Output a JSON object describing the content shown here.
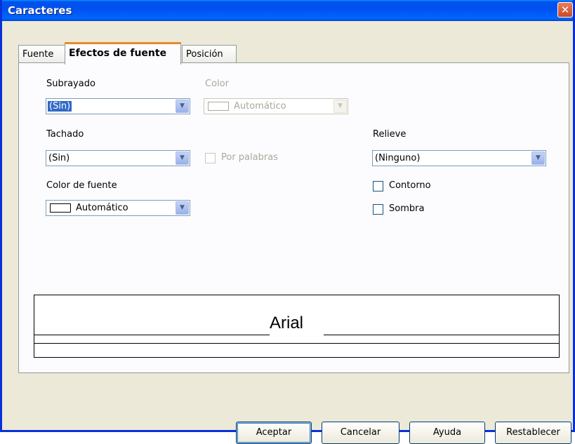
{
  "window": {
    "title": "Caracteres",
    "close_glyph": "✕"
  },
  "tabs": [
    {
      "label": "Fuente"
    },
    {
      "label": "Efectos de fuente"
    },
    {
      "label": "Posición"
    }
  ],
  "subrayado": {
    "label": "Subrayado",
    "value": "(Sin)"
  },
  "color": {
    "label": "Color",
    "value": "Automático"
  },
  "tachado": {
    "label": "Tachado",
    "value": "(Sin)"
  },
  "por_palabras": {
    "label": "Por palabras",
    "checked": false
  },
  "relieve": {
    "label": "Relieve",
    "value": "(Ninguno)"
  },
  "color_fuente": {
    "label": "Color de fuente",
    "value": "Automático"
  },
  "contorno": {
    "label": "Contorno",
    "checked": false
  },
  "sombra": {
    "label": "Sombra",
    "checked": false
  },
  "preview": {
    "text": "Arial"
  },
  "buttons": {
    "ok": "Aceptar",
    "cancel": "Cancelar",
    "help": "Ayuda",
    "reset": "Restablecer"
  },
  "icons": {
    "dropdown": "chevron-down-icon",
    "close": "close-icon"
  },
  "colors": {
    "titlebar": "#0054e3",
    "tab_accent": "#e68b2c",
    "selection": "#316ac5"
  }
}
